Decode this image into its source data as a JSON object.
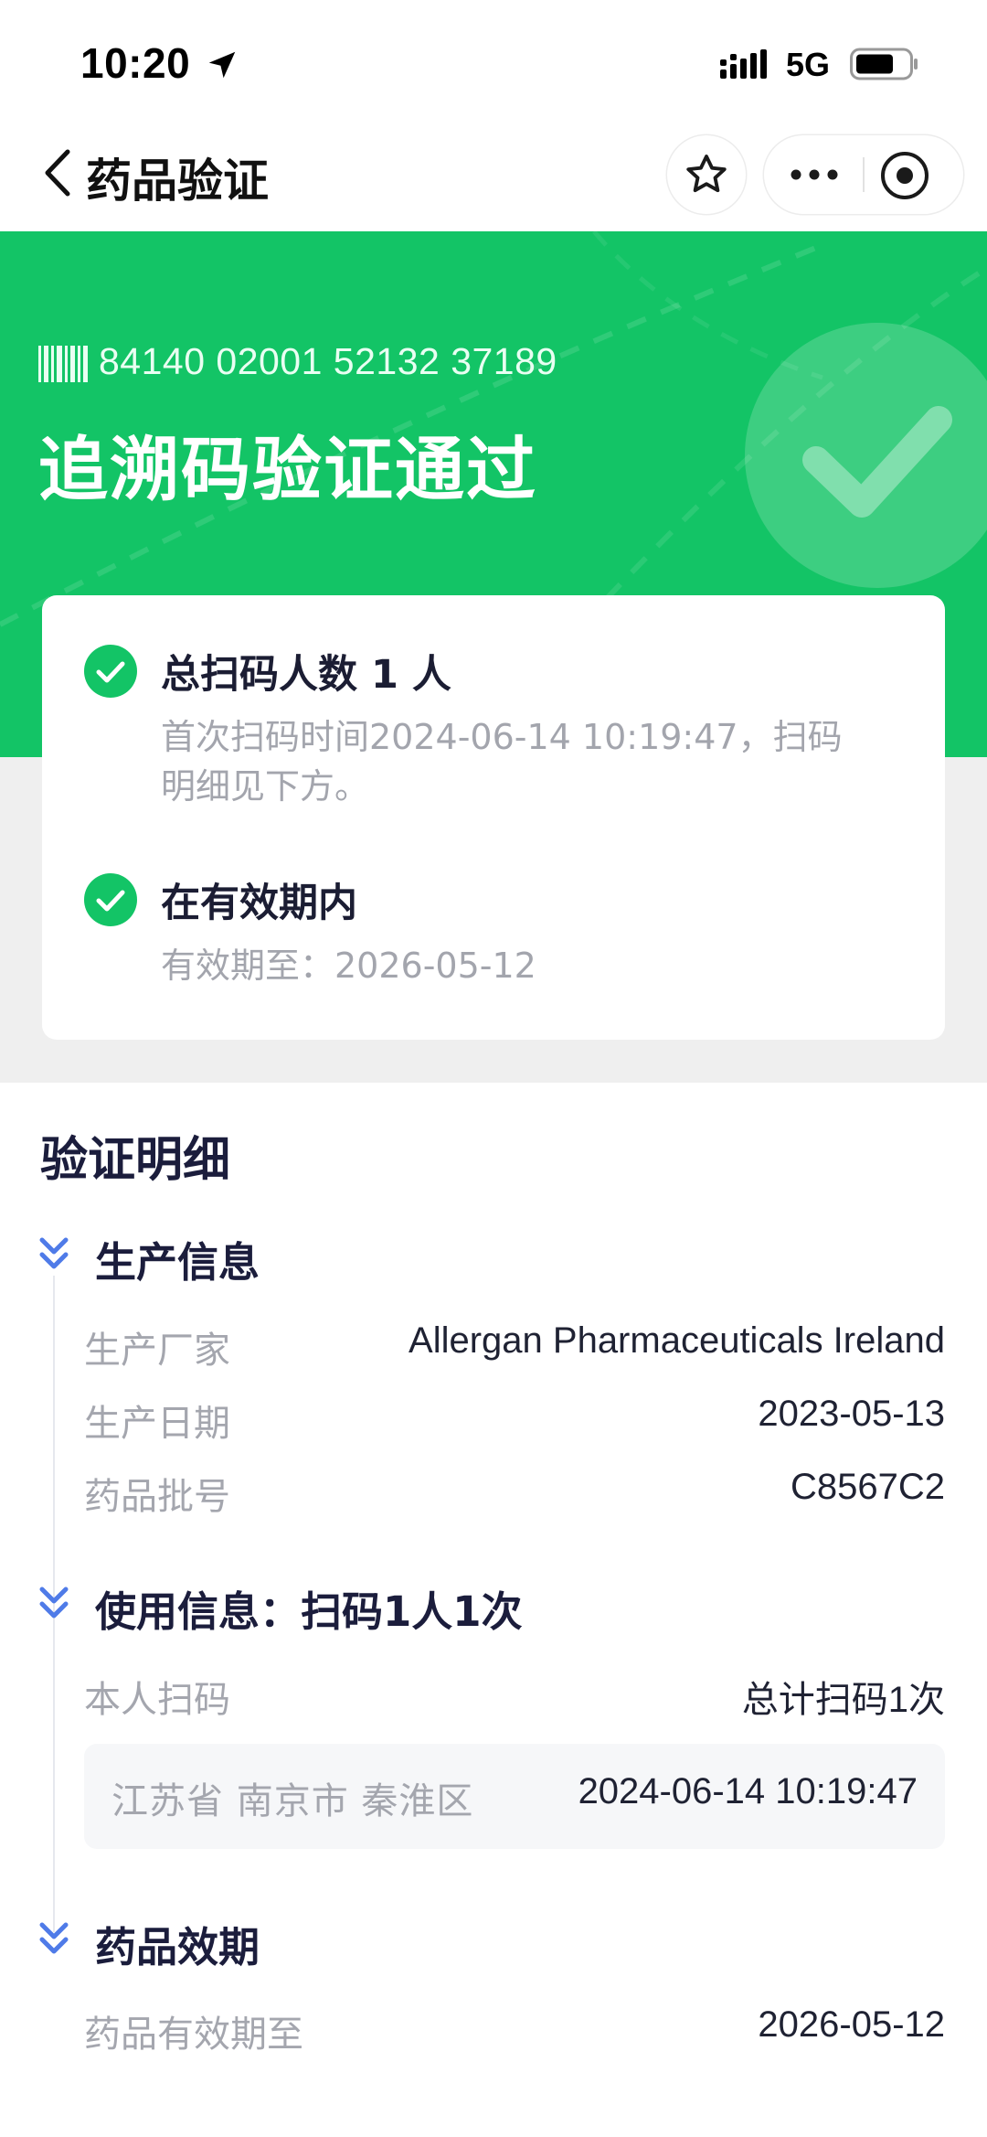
{
  "status_bar": {
    "time": "10:20",
    "network": "5G"
  },
  "nav": {
    "title": "药品验证"
  },
  "hero": {
    "code": "84140 02001 52132 37189",
    "title": "追溯码验证通过",
    "color": "#13c466"
  },
  "result_card": {
    "items": [
      {
        "title": "总扫码人数 1 人",
        "subtitle_line1": "首次扫码时间2024-06-14 10:19:47，扫码",
        "subtitle_line2": "明细见下方。"
      },
      {
        "title": "在有效期内",
        "subtitle_line1": "有效期至：2026-05-12"
      }
    ]
  },
  "details": {
    "title": "验证明细",
    "production": {
      "title": "生产信息",
      "rows": [
        {
          "label": "生产厂家",
          "value": "Allergan Pharmaceuticals Ireland"
        },
        {
          "label": "生产日期",
          "value": "2023-05-13"
        },
        {
          "label": "药品批号",
          "value": "C8567C2"
        }
      ]
    },
    "usage": {
      "title": "使用信息：扫码1人1次",
      "row": {
        "label": "本人扫码",
        "value": "总计扫码1次"
      },
      "scan": {
        "place": "江苏省 南京市 秦淮区",
        "time": "2024-06-14 10:19:47"
      }
    },
    "expiry": {
      "title": "药品效期",
      "row": {
        "label": "药品有效期至",
        "value": "2026-05-12"
      }
    }
  }
}
